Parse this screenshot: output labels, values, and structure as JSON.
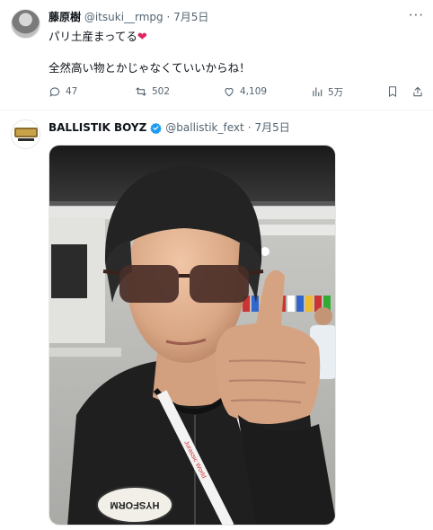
{
  "tweet1": {
    "author_name": "藤原樹",
    "author_handle": "@itsuki__rmpg",
    "separator": "·",
    "date": "7月5日",
    "line1": "パリ土産まってる",
    "line2": "全然高い物とかじゃなくていいからね！",
    "stats": {
      "replies": "47",
      "retweets": "502",
      "likes": "4,109",
      "views": "5万"
    }
  },
  "tweet2": {
    "author_name": "BALLISTIK BOYZ",
    "author_handle": "@ballistik_fext",
    "separator": "·",
    "date": "7月5日",
    "avatar_logo_text": "BBZ",
    "lanyard_text": "Jurassic World",
    "sweatshirt_patch_text": "HYSFORM"
  },
  "more_label": "···",
  "colors": {
    "text": "#0f1419",
    "secondary": "#536471",
    "heart": "#e0245e",
    "verified": "#1d9bf0"
  }
}
